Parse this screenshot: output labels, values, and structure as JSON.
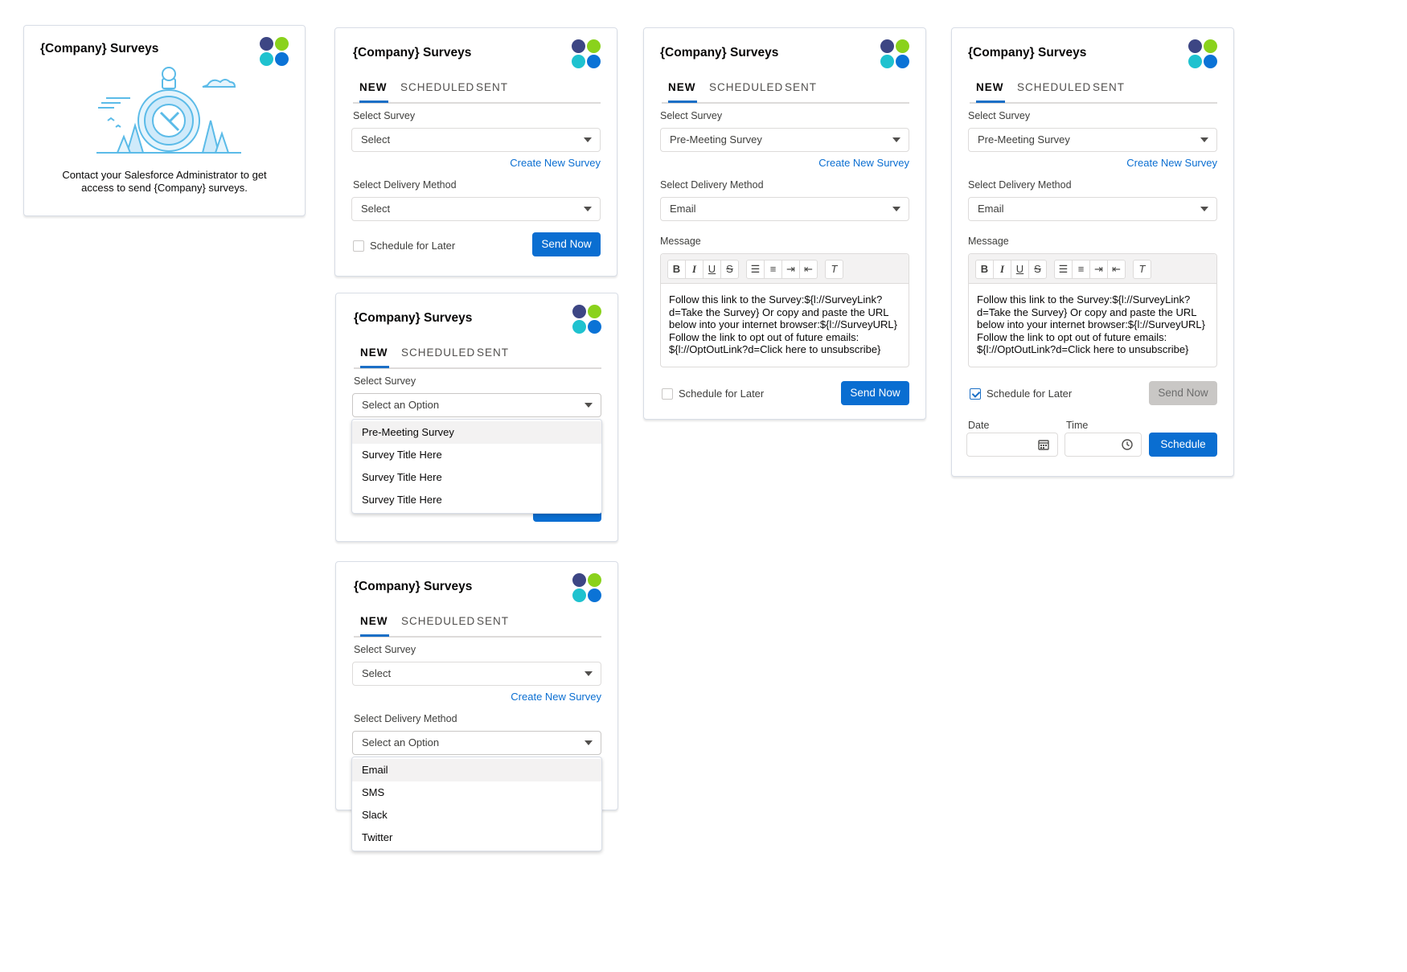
{
  "app_title": "{Company} Surveys",
  "tabs": [
    "NEW",
    "SCHEDULED",
    "SENT"
  ],
  "labels": {
    "select_survey": "Select Survey",
    "select_delivery": "Select Delivery Method",
    "message": "Message",
    "date": "Date",
    "time": "Time"
  },
  "values": {
    "select": "Select",
    "select_option": "Select an Option",
    "survey_selected": "Pre-Meeting Survey",
    "delivery_selected": "Email"
  },
  "create_new_survey": "Create New Survey",
  "schedule_for_later": "Schedule for Later",
  "send_now": "Send Now",
  "schedule": "Schedule",
  "no_access_message": "Contact your Salesforce Administrator to get access to send {Company} surveys.",
  "survey_options": [
    "Pre-Meeting Survey",
    "Survey Title Here",
    "Survey Title Here",
    "Survey Title Here"
  ],
  "delivery_options": [
    "Email",
    "SMS",
    "Slack",
    "Twitter"
  ],
  "message_body": "Follow this link to the Survey:${l://SurveyLink?d=Take the Survey} Or copy and paste the URL below into your internet browser:${l://SurveyURL} Follow the link to opt out of future emails: ${l://OptOutLink?d=Click here to unsubscribe}",
  "toolbar_icons": [
    "bold-icon",
    "italic-icon",
    "underline-icon",
    "strikethrough-icon",
    "bullet-list-icon",
    "numbered-list-icon",
    "indent-icon",
    "outdent-icon",
    "clear-format-icon"
  ],
  "colors": {
    "brand": "#0a6ed1",
    "logo": [
      "#3d4684",
      "#8ad21c",
      "#1fc2cf",
      "#0b73d6"
    ]
  }
}
